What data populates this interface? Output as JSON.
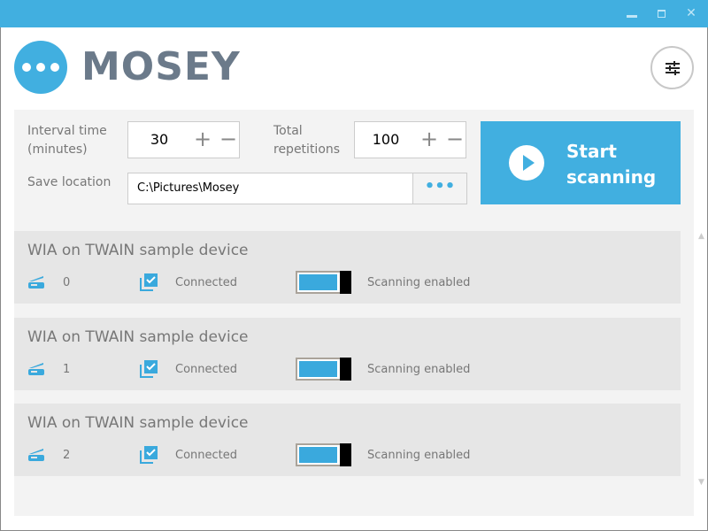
{
  "window": {
    "controls": [
      "minimize",
      "maximize",
      "close"
    ],
    "accent": "#41afe0"
  },
  "header": {
    "brand": "MOSEY",
    "settings_icon": "sliders-icon"
  },
  "controls": {
    "interval_label_1": "Interval time",
    "interval_label_2": "(minutes)",
    "interval_value": "30",
    "repetitions_label_1": "Total",
    "repetitions_label_2": "repetitions",
    "repetitions_value": "100",
    "plus": "+",
    "minus": "−",
    "save_label": "Save location",
    "save_path": "C:\\Pictures\\Mosey",
    "browse": "•••",
    "start_1": "Start",
    "start_2": "scanning"
  },
  "devices": [
    {
      "name": "WIA on TWAIN sample device",
      "index": "0",
      "status": "Connected",
      "toggle": "Scanning enabled",
      "enabled": true
    },
    {
      "name": "WIA on TWAIN sample device",
      "index": "1",
      "status": "Connected",
      "toggle": "Scanning enabled",
      "enabled": true
    },
    {
      "name": "WIA on TWAIN sample device",
      "index": "2",
      "status": "Connected",
      "toggle": "Scanning enabled",
      "enabled": true
    }
  ]
}
